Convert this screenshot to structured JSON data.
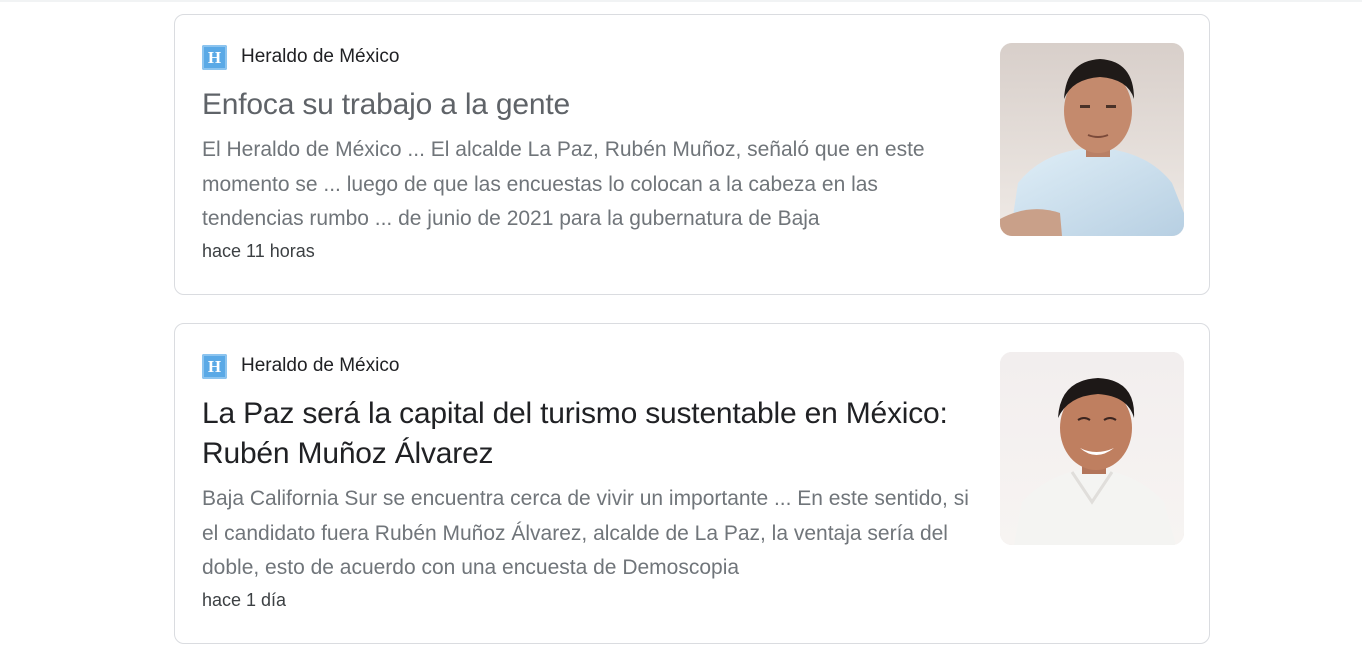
{
  "articles": [
    {
      "source": "Heraldo de México",
      "favicon_letter": "H",
      "title": "Enfoca su trabajo a la gente",
      "snippet": "El Heraldo de México ... El alcalde La Paz, Rubén Muñoz, señaló que en este momento se ... luego de que las encuestas lo colocan a la cabeza en las tendencias rumbo ... de junio de 2021 para la gubernatura de Baja",
      "time": "hace 11 horas"
    },
    {
      "source": "Heraldo de México",
      "favicon_letter": "H",
      "title": "La Paz será la capital del turismo sustentable en México: Rubén Muñoz Álvarez",
      "snippet": "Baja California Sur se encuentra cerca de vivir un importante ... En este sentido, si el candidato fuera Rubén Muñoz Álvarez, alcalde de La Paz, la ventaja sería del doble, esto de acuerdo con una encuesta de Demoscopia",
      "time": "hace 1 día"
    }
  ],
  "colors": {
    "favicon": "#5aa9e6",
    "title_visited": "#5f6368",
    "title": "#202124",
    "snippet": "#70757a",
    "border": "#dadce0"
  }
}
